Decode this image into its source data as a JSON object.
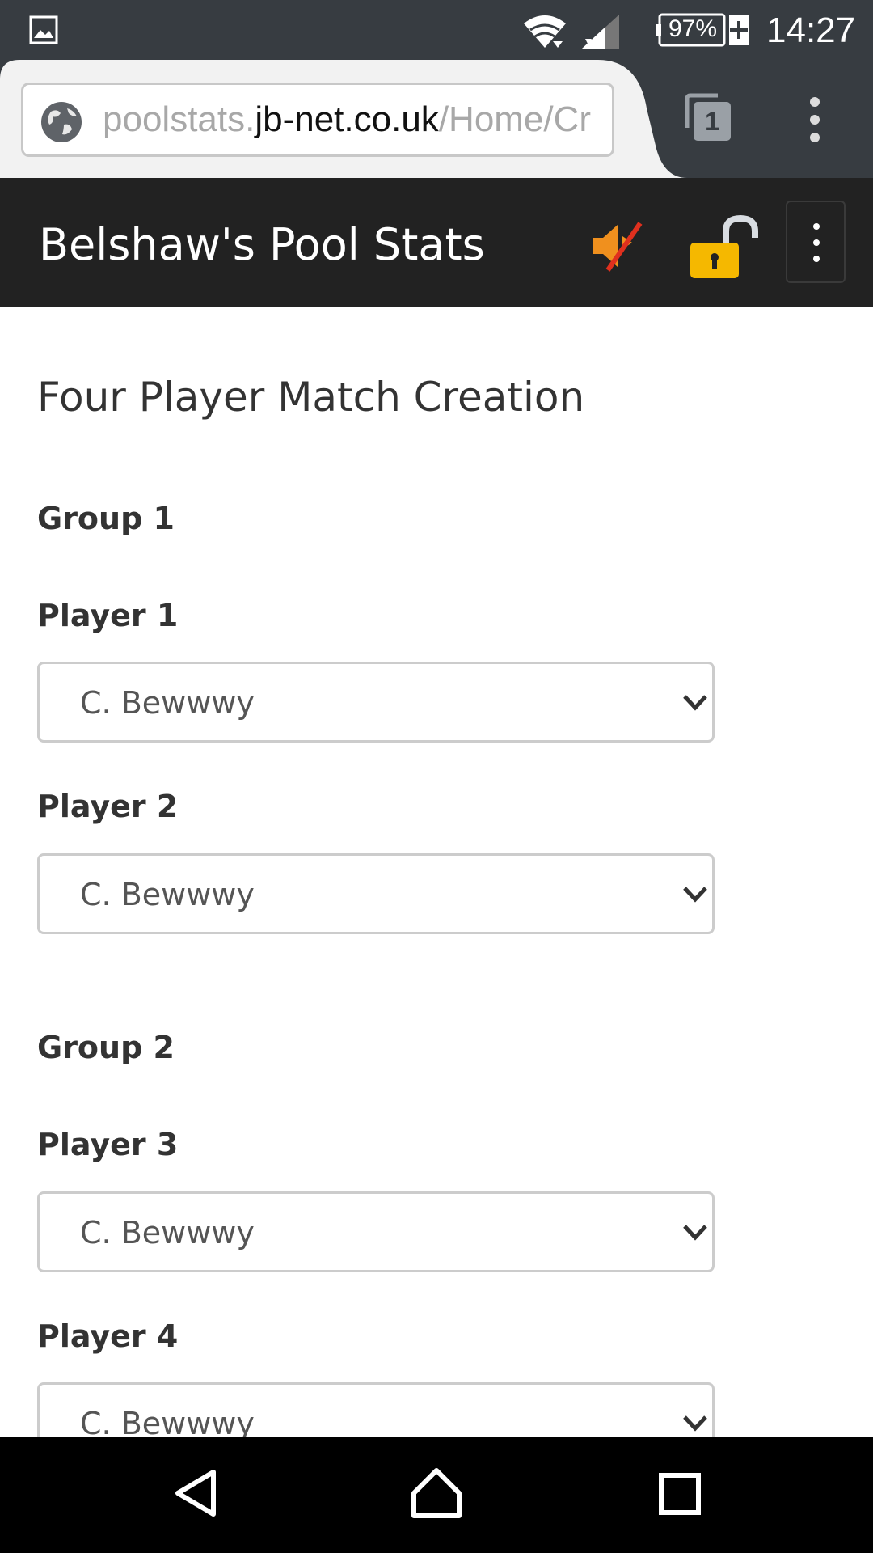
{
  "status_bar": {
    "battery": "97%",
    "time": "14:27"
  },
  "browser": {
    "url_prefix": "poolstats.",
    "url_domain": "jb-net.co.uk",
    "url_path": "/Home/Cr",
    "tab_count": "1"
  },
  "header": {
    "title": "Belshaw's Pool Stats"
  },
  "main": {
    "title": "Four Player Match Creation",
    "groups": [
      {
        "label": "Group 1",
        "players": [
          {
            "label": "Player 1",
            "value": "C. Bewwwy"
          },
          {
            "label": "Player 2",
            "value": "C. Bewwwy"
          }
        ]
      },
      {
        "label": "Group 2",
        "players": [
          {
            "label": "Player 3",
            "value": "C. Bewwwy"
          },
          {
            "label": "Player 4",
            "value": "C. Bewwwy"
          }
        ]
      }
    ]
  },
  "colors": {
    "status_bar_bg": "#373c41",
    "header_bg": "#222222",
    "mute_icon": "#f0901e",
    "lock_icon": "#f5b800"
  },
  "icons": [
    "image-notification-icon",
    "wifi-icon",
    "signal-icon",
    "battery-icon",
    "globe-icon",
    "tabs-icon",
    "overflow-menu-icon",
    "mute-icon",
    "unlocked-padlock-icon",
    "chevron-down-icon",
    "back-icon",
    "home-icon",
    "recents-icon"
  ]
}
